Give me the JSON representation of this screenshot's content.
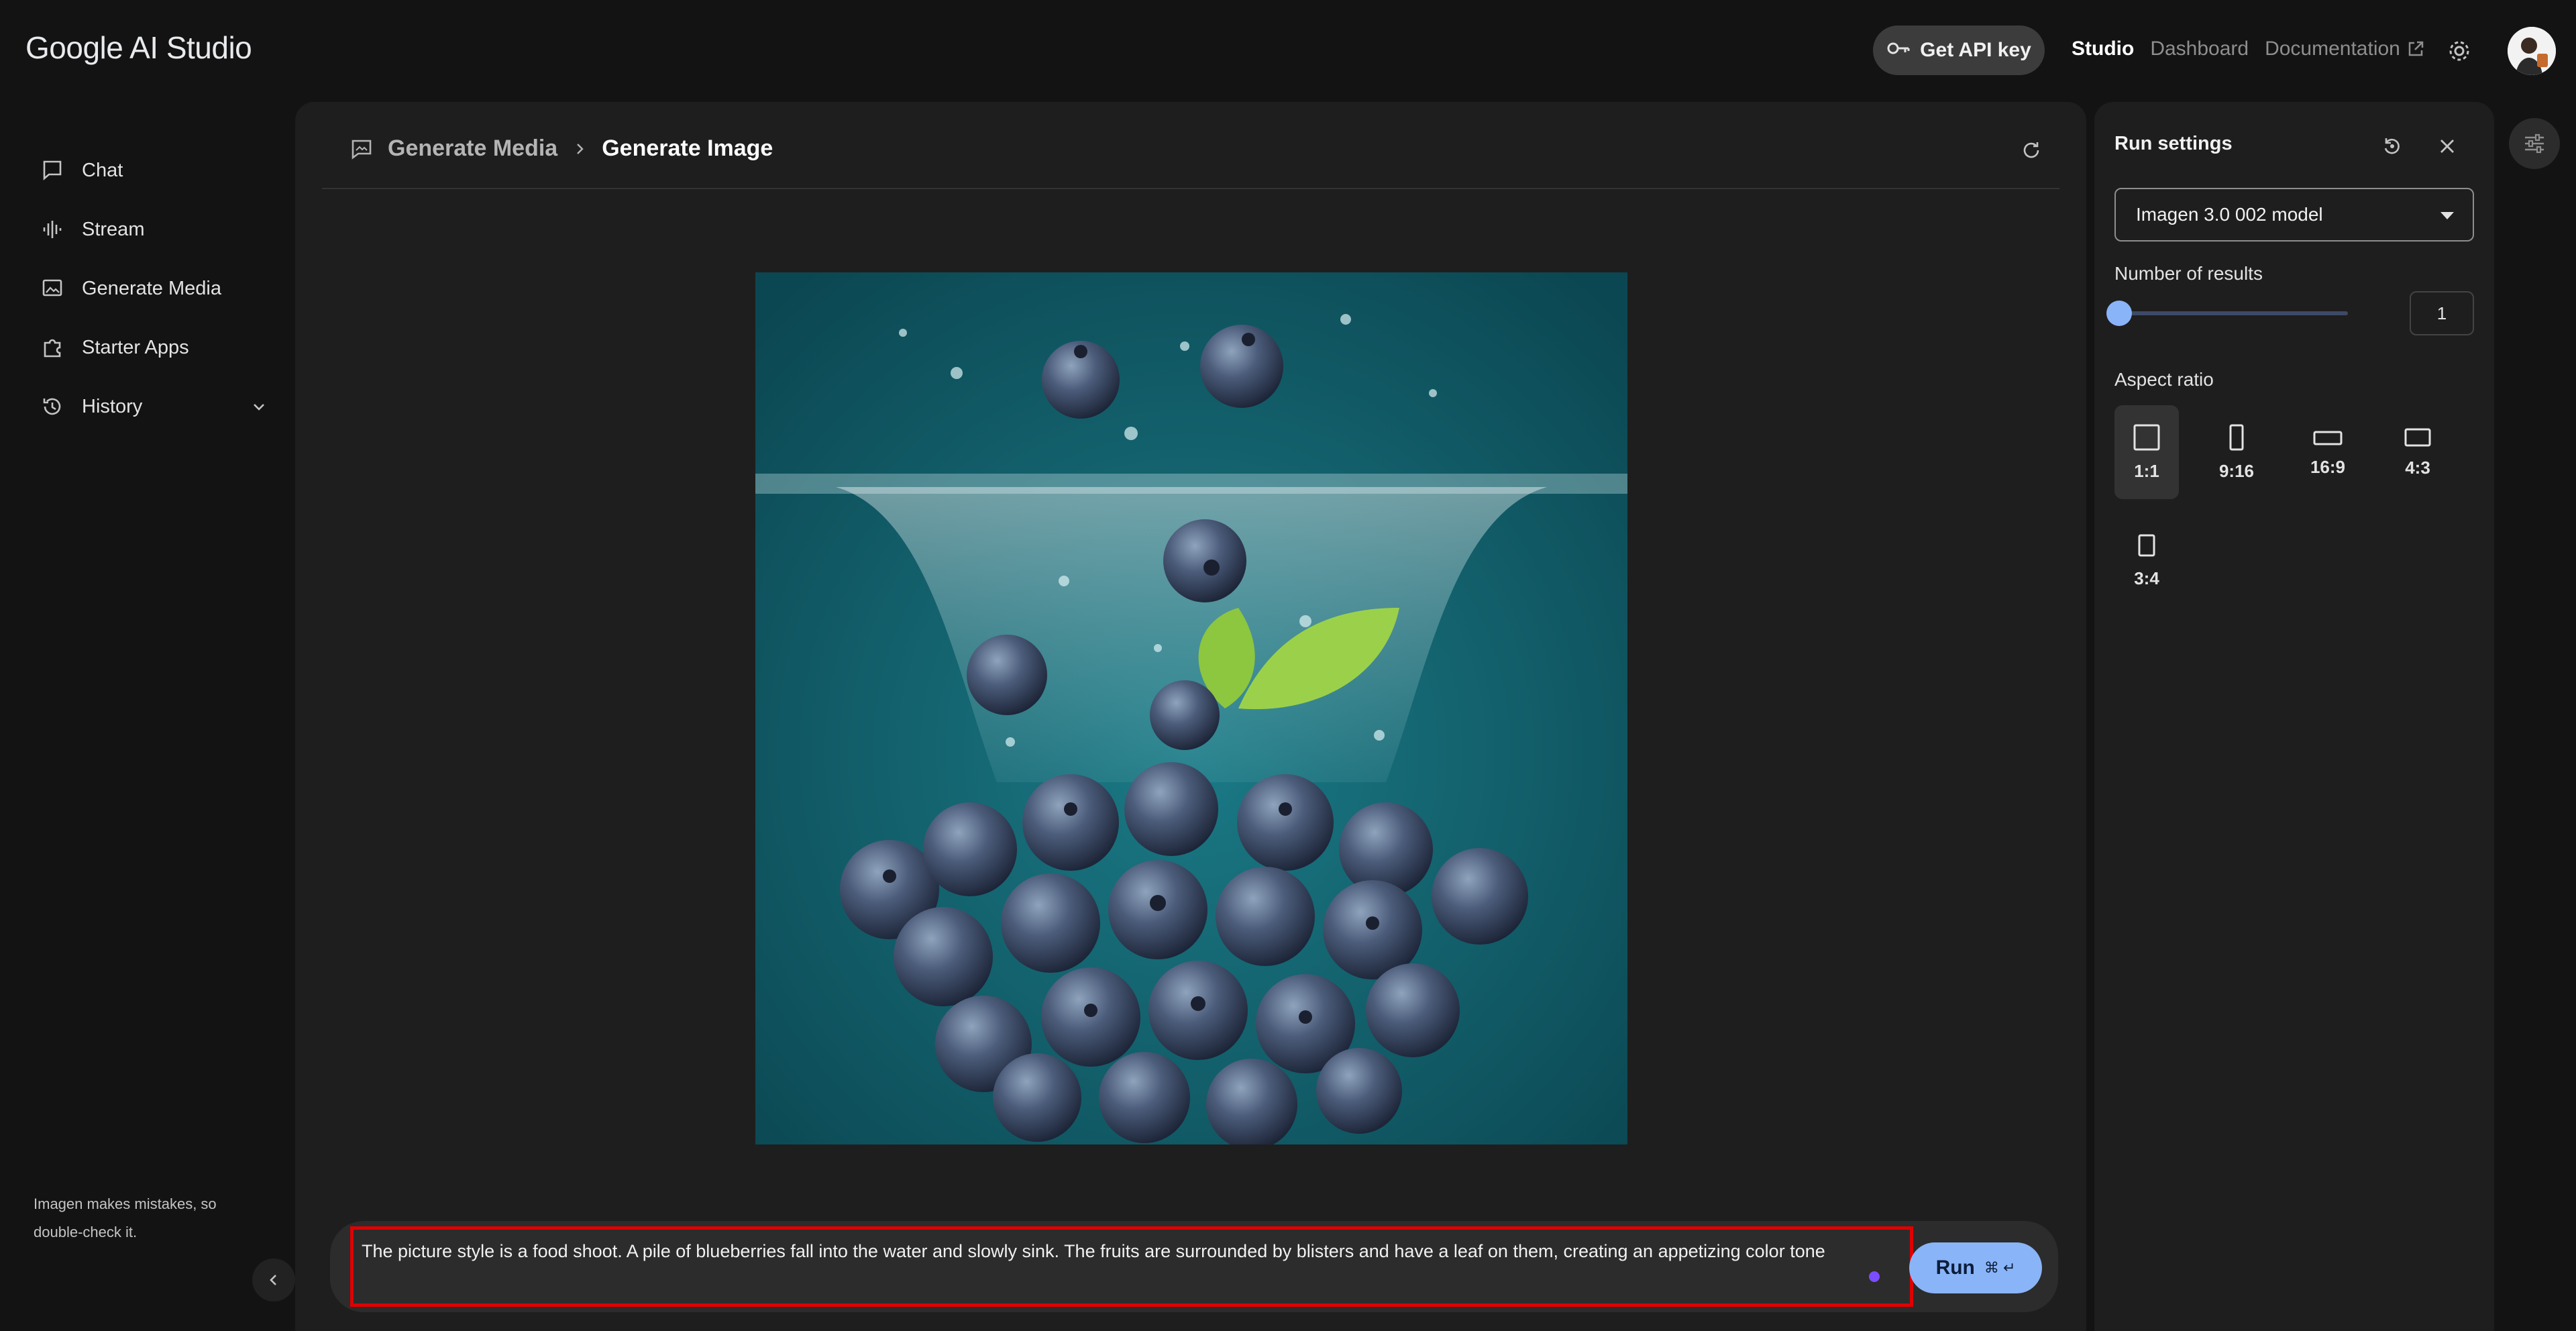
{
  "app": {
    "logo": "Google AI Studio",
    "get_api_key": "Get API key",
    "nav": {
      "studio": "Studio",
      "dashboard": "Dashboard",
      "documentation": "Documentation"
    }
  },
  "sidebar": {
    "items": [
      {
        "label": "Chat",
        "icon": "chat-icon"
      },
      {
        "label": "Stream",
        "icon": "stream-icon"
      },
      {
        "label": "Generate Media",
        "icon": "image-icon"
      },
      {
        "label": "Starter Apps",
        "icon": "puzzle-icon"
      },
      {
        "label": "History",
        "icon": "history-icon"
      }
    ],
    "disclaimer": "Imagen makes mistakes, so double-check it."
  },
  "main": {
    "breadcrumb": {
      "parent": "Generate Media",
      "current": "Generate Image"
    },
    "image_description": "Blueberries falling into teal water with bubbles and a green leaf",
    "prompt": "The picture style is a food shoot. A pile of blueberries fall into the water and slowly sink. The fruits are surrounded by blisters and have a leaf on them, creating an appetizing color tone",
    "run": {
      "label": "Run",
      "shortcut": "⌘ ↵"
    }
  },
  "run_settings": {
    "title": "Run settings",
    "model": "Imagen 3.0 002 model",
    "number_of_results_label": "Number of results",
    "number_of_results": "1",
    "aspect_ratio_label": "Aspect ratio",
    "aspect_ratios": [
      "1:1",
      "9:16",
      "16:9",
      "4:3",
      "3:4"
    ],
    "selected_ratio": "1:1"
  },
  "colors": {
    "background": "#131313",
    "panel": "#1e1e1e",
    "accent": "#8ab4f8",
    "highlight_border": "#e00000",
    "image_water": "#0e5763"
  }
}
